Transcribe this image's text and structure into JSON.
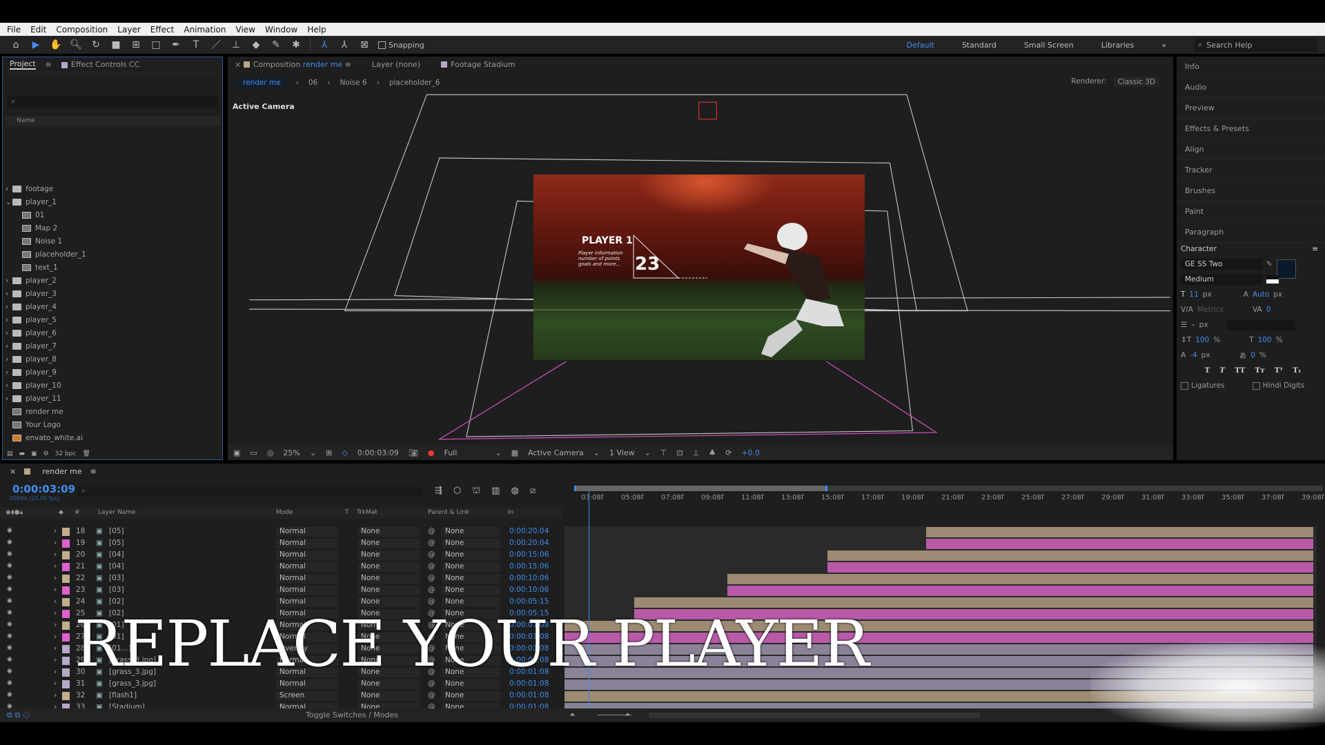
{
  "menu": [
    "File",
    "Edit",
    "Composition",
    "Layer",
    "Effect",
    "Animation",
    "View",
    "Window",
    "Help"
  ],
  "toolbar": {
    "snapping": "Snapping",
    "workspaces": [
      "Default",
      "Standard",
      "Small Screen",
      "Libraries"
    ],
    "active_workspace": "Default",
    "search_placeholder": "Search Help"
  },
  "project": {
    "tabs": [
      "Project",
      "Effect Controls CC"
    ],
    "column_name": "Name",
    "search_placeholder": "⌕",
    "items": [
      {
        "label": "footage",
        "type": "folder",
        "depth": 0,
        "expanded": false
      },
      {
        "label": "player_1",
        "type": "folder",
        "depth": 0,
        "expanded": true
      },
      {
        "label": "01",
        "type": "comp",
        "depth": 1
      },
      {
        "label": "Map 2",
        "type": "comp",
        "depth": 1
      },
      {
        "label": "Noise 1",
        "type": "comp",
        "depth": 1
      },
      {
        "label": "placeholder_1",
        "type": "comp",
        "depth": 1
      },
      {
        "label": "text_1",
        "type": "comp",
        "depth": 1
      },
      {
        "label": "player_2",
        "type": "folder",
        "depth": 0
      },
      {
        "label": "player_3",
        "type": "folder",
        "depth": 0
      },
      {
        "label": "player_4",
        "type": "folder",
        "depth": 0
      },
      {
        "label": "player_5",
        "type": "folder",
        "depth": 0
      },
      {
        "label": "player_6",
        "type": "folder",
        "depth": 0
      },
      {
        "label": "player_7",
        "type": "folder",
        "depth": 0
      },
      {
        "label": "player_8",
        "type": "folder",
        "depth": 0
      },
      {
        "label": "player_9",
        "type": "folder",
        "depth": 0
      },
      {
        "label": "player_10",
        "type": "folder",
        "depth": 0
      },
      {
        "label": "player_11",
        "type": "folder",
        "depth": 0
      },
      {
        "label": "render me",
        "type": "comp",
        "depth": 0
      },
      {
        "label": "Your Logo",
        "type": "comp",
        "depth": 0
      },
      {
        "label": "envato_white.ai",
        "type": "ai",
        "depth": 0
      }
    ],
    "bpc": "32 bpc"
  },
  "composition": {
    "tab_prefix": "Composition",
    "tab_name": "render me",
    "layer_tab": "Layer (none)",
    "footage_tab": "Footage Stadium",
    "breadcrumbs": [
      "render me",
      "06",
      "Noise 6",
      "placeholder_6"
    ],
    "renderer_label": "Renderer:",
    "renderer_value": "Classic 3D",
    "active_camera_label": "Active Camera",
    "card": {
      "title": "PLAYER 1",
      "info": "Player information number of points goals and more...",
      "number": "23"
    },
    "viewer_bar": {
      "zoom": "25%",
      "timecode": "0:00:03:09",
      "resolution": "Full",
      "camera": "Active Camera",
      "views": "1 View",
      "exposure": "+0.0"
    }
  },
  "right_panel": {
    "items": [
      "Info",
      "Audio",
      "Preview",
      "Effects & Presets",
      "Align",
      "Tracker",
      "Brushes",
      "Paint",
      "Paragraph"
    ],
    "character": {
      "title": "Character",
      "font": "GE SS Two",
      "style": "Medium",
      "size": "11",
      "size_unit": "px",
      "leading": "Auto",
      "leading_unit": "px",
      "kerning": "Metrics",
      "tracking": "0",
      "stroke": "–",
      "stroke_unit": "px",
      "vscale": "100",
      "hscale": "100",
      "baseline": "-4",
      "baseline_unit": "px",
      "tsume": "0",
      "pct": "%",
      "ligatures": "Ligatures",
      "hindi_digits": "Hindi Digits",
      "fill_color": "#0b1a2a"
    }
  },
  "timeline": {
    "tab": "render me",
    "timecode": "0:00:03:09",
    "timecode_sub": "00084 (25.00 fps)",
    "columns": {
      "layer_name": "Layer Name",
      "mode": "Mode",
      "t": "T",
      "trkmat": "TrkMat",
      "parent": "Parent & Link",
      "in": "In"
    },
    "ruler": [
      "03:08f",
      "05:08f",
      "07:08f",
      "09:08f",
      "11:08f",
      "13:08f",
      "15:08f",
      "17:08f",
      "19:08f",
      "21:08f",
      "23:08f",
      "25:08f",
      "27:08f",
      "29:08f",
      "31:08f",
      "33:08f",
      "35:08f",
      "37:08f",
      "39:08f"
    ],
    "layers": [
      {
        "num": "18",
        "name": "[05]",
        "label": "#c2ae8f",
        "mode": "Normal",
        "trkmat": "None",
        "parent": "None",
        "in": "0:00:20:04",
        "start_s": 20.16
      },
      {
        "num": "19",
        "name": "[05]",
        "label": "#e060d0",
        "mode": "Normal",
        "trkmat": "None",
        "parent": "None",
        "in": "0:00:20:04",
        "start_s": 20.16
      },
      {
        "num": "20",
        "name": "[04]",
        "label": "#c2ae8f",
        "mode": "Normal",
        "trkmat": "None",
        "parent": "None",
        "in": "0:00:15:06",
        "start_s": 15.24
      },
      {
        "num": "21",
        "name": "[04]",
        "label": "#e060d0",
        "mode": "Normal",
        "trkmat": "None",
        "parent": "None",
        "in": "0:00:15:06",
        "start_s": 15.24
      },
      {
        "num": "22",
        "name": "[03]",
        "label": "#c2ae8f",
        "mode": "Normal",
        "trkmat": "None",
        "parent": "None",
        "in": "0:00:10:06",
        "start_s": 10.24
      },
      {
        "num": "23",
        "name": "[03]",
        "label": "#e060d0",
        "mode": "Normal",
        "trkmat": "None",
        "parent": "None",
        "in": "0:00:10:06",
        "start_s": 10.24
      },
      {
        "num": "24",
        "name": "[02]",
        "label": "#c2ae8f",
        "mode": "Normal",
        "trkmat": "None",
        "parent": "None",
        "in": "0:00:05:15",
        "start_s": 5.6
      },
      {
        "num": "25",
        "name": "[02]",
        "label": "#e060d0",
        "mode": "Normal",
        "trkmat": "None",
        "parent": "None",
        "in": "0:00:05:15",
        "start_s": 5.6
      },
      {
        "num": "26",
        "name": "[01]",
        "label": "#c2ae8f",
        "mode": "Normal",
        "trkmat": "None",
        "parent": "None",
        "in": "0:00:01:08",
        "start_s": 1.32
      },
      {
        "num": "27",
        "name": "[01]",
        "label": "#e060d0",
        "mode": "Normal",
        "trkmat": "None",
        "parent": "None",
        "in": "0:00:01:08",
        "start_s": 1.32
      },
      {
        "num": "28",
        "name": "[01...]",
        "label": "#b6a8c8",
        "mode": "Overlay",
        "trkmat": "None",
        "parent": "None",
        "in": "0:00:01:08",
        "start_s": 1.32
      },
      {
        "num": "29",
        "name": "[grass_3.jpg]",
        "label": "#b6a8c8",
        "mode": "Normal",
        "trkmat": "None",
        "parent": "None",
        "in": "0:00:01:08",
        "start_s": 1.32
      },
      {
        "num": "30",
        "name": "[grass_3.jpg]",
        "label": "#b6a8c8",
        "mode": "Normal",
        "trkmat": "None",
        "parent": "None",
        "in": "0:00:01:08",
        "start_s": 1.32
      },
      {
        "num": "31",
        "name": "[grass_3.jpg]",
        "label": "#b6a8c8",
        "mode": "Normal",
        "trkmat": "None",
        "parent": "None",
        "in": "0:00:01:08",
        "start_s": 1.32
      },
      {
        "num": "32",
        "name": "[flash1]",
        "label": "#c2ae8f",
        "mode": "Screen",
        "trkmat": "None",
        "parent": "None",
        "in": "0:00:01:08",
        "start_s": 1.32
      },
      {
        "num": "33",
        "name": "[Stadium]",
        "label": "#b6a8c8",
        "mode": "Normal",
        "trkmat": "None",
        "parent": "None",
        "in": "0:00:01:08",
        "start_s": 1.32
      }
    ],
    "toggle_label": "Toggle Switches / Modes"
  },
  "overlay_title": "REPLACE YOUR PLAYER",
  "colors": {
    "accent": "#3f8ef0",
    "bar_tan": "#9c8a72",
    "bar_pink": "#b85aa8",
    "bar_lavender": "#8a8298",
    "panel_bg": "#1e1e1e"
  }
}
